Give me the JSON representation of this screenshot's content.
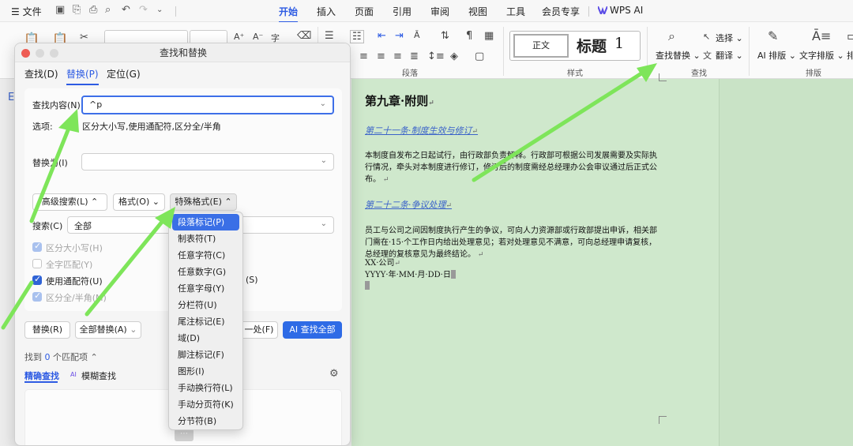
{
  "menubar": {
    "file": "文件",
    "tabs": [
      "开始",
      "插入",
      "页面",
      "引用",
      "审阅",
      "视图",
      "工具",
      "会员专享",
      "WPS AI"
    ],
    "active_tab": "开始"
  },
  "ribbon": {
    "paragraph_label": "段落",
    "styles_label": "样式",
    "find_label": "查找",
    "layout_label": "排版",
    "style_normal": "正文",
    "style_heading1": "标题",
    "style_heading1_num": "1",
    "select": "选择",
    "find_replace": "查找替换",
    "translate": "翻译",
    "ai_layout": "AI 排版",
    "text_layout": "文字排版",
    "more_cut": "排"
  },
  "document": {
    "chapter": "第九章·附则",
    "article21": "第二十一条·制度生效与修订",
    "para1": "本制度自发布之日起试行，由行政部负责解释。行政部可根据公司发展需要及实际执行情况，牵头对本制度进行修订，修订后的制度需经总经理办公会审议通过后正式公布。",
    "article22": "第二十二条·争议处理",
    "para2": "员工与公司之间因制度执行产生的争议，可向人力资源部或行政部提出申诉，相关部门需在·15·个工作日内给出处理意见；若对处理意见不满意，可向总经理申请复核，总经理的复核意见为最终结论。",
    "company": "XX·公司",
    "date": "YYYY·年·MM·月·DD·日"
  },
  "dialog": {
    "title": "查找和替换",
    "tabs": [
      "查找(D)",
      "替换(P)",
      "定位(G)"
    ],
    "active_tab": "替换(P)",
    "find_label": "查找内容(N)",
    "find_value": "^p",
    "options_label": "选项:",
    "options_value": "区分大小写,使用通配符,区分全/半角",
    "replace_label": "替换为(I)",
    "replace_value": "",
    "advanced_btn": "高级搜索(L)",
    "format_btn": "格式(O)",
    "special_btn": "特殊格式(E)",
    "search_label": "搜索(C)",
    "search_value": "全部",
    "checkboxes": {
      "case": "区分大小写(H)",
      "whole": "全字匹配(Y)",
      "wildcard": "使用通配符(U)",
      "width": "区分全/半角(M)",
      "hidden_right": "(S)"
    },
    "replace_btn": "替换(R)",
    "replace_all_btn": "全部替换(A)",
    "find_next_btn": "一处(F)",
    "ai_find_all_btn": "AI 查找全部",
    "found_prefix": "找到",
    "found_count": "0",
    "found_suffix": "个匹配项",
    "exact_tab": "精确查找",
    "fuzzy_tab": "模糊查找"
  },
  "special_menu": [
    "段落标记(P)",
    "制表符(T)",
    "任意字符(C)",
    "任意数字(G)",
    "任意字母(Y)",
    "分栏符(U)",
    "尾注标记(E)",
    "域(D)",
    "脚注标记(F)",
    "图形(I)",
    "手动换行符(L)",
    "手动分页符(K)",
    "分节符(B)"
  ],
  "colors": {
    "accent": "#2d5be3",
    "doc_bg": "#cfe8cc",
    "arrow": "#7ee55a"
  }
}
